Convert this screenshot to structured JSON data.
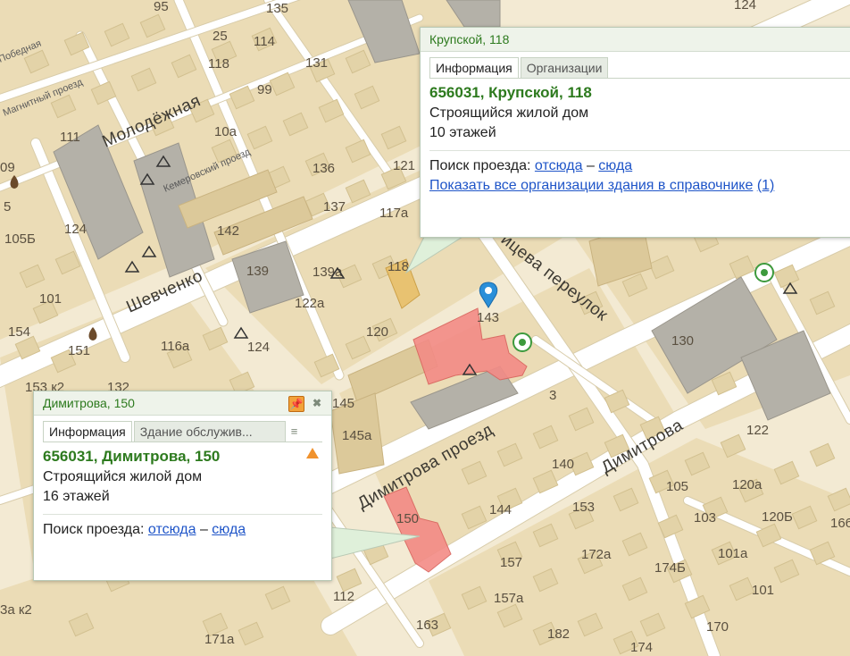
{
  "map": {
    "colors": {
      "background": "#f3ead3",
      "block": "#ebdcb6",
      "building": "#e3d3a8",
      "highrise": "#a8a8a8",
      "road": "#ffffff",
      "highlight_red": "#f38b86",
      "highlight_yellow": "#e8c06a"
    },
    "house_numbers": [
      "95",
      "135",
      "25",
      "114",
      "118",
      "131",
      "99",
      "111",
      "10а",
      "136",
      "121",
      "137",
      "117а",
      "124",
      "142",
      "105Б",
      "139",
      "139а",
      "118",
      "101",
      "122а",
      "154",
      "151",
      "120",
      "143",
      "116а",
      "124",
      "130",
      "145",
      "153 к2",
      "132",
      "145а",
      "3",
      "122",
      "140",
      "105",
      "120а",
      "153",
      "120Б",
      "144",
      "103",
      "166",
      "150",
      "172а",
      "174Б",
      "101а",
      "157",
      "101",
      "112",
      "157а",
      "163",
      "170",
      "171а",
      "182",
      "174",
      "124",
      "09",
      "3а к2",
      "5"
    ],
    "street_labels": [
      "Молодёжная",
      "Шевченко",
      "Димитрова проезд",
      "Димитрова",
      "ицева переулок",
      "Магнитный проезд",
      "Кемеровский проезд",
      "Победная"
    ],
    "markers": {
      "pin": "map-pin-icon",
      "recycle": "recycle-icon",
      "theatre": "theatre-icon",
      "fuel": "fuel-icon"
    }
  },
  "popup_top": {
    "title": "Крупской, 118",
    "tabs": [
      "Информация",
      "Организации"
    ],
    "address": "656031, Крупской, 118",
    "line1": "Строящийся жилой дом",
    "line2": "10 этажей",
    "route_label": "Поиск проезда:",
    "route_from": "отсюда",
    "route_dash": "–",
    "route_to": "сюда",
    "orgs_link": "Показать все организации здания в справочнике",
    "orgs_count": "(1)"
  },
  "popup_bottom": {
    "title": "Димитрова, 150",
    "tabs": [
      "Информация",
      "Здание обслужив..."
    ],
    "address": "656031, Димитрова, 150",
    "line1": "Строящийся жилой дом",
    "line2": "16 этажей",
    "route_label": "Поиск проезда:",
    "route_from": "отсюда",
    "route_dash": "–",
    "route_to": "сюда",
    "icons": {
      "pin": "pin-icon",
      "close": "close-icon",
      "menu": "menu-icon",
      "warning": "warning-icon"
    }
  }
}
